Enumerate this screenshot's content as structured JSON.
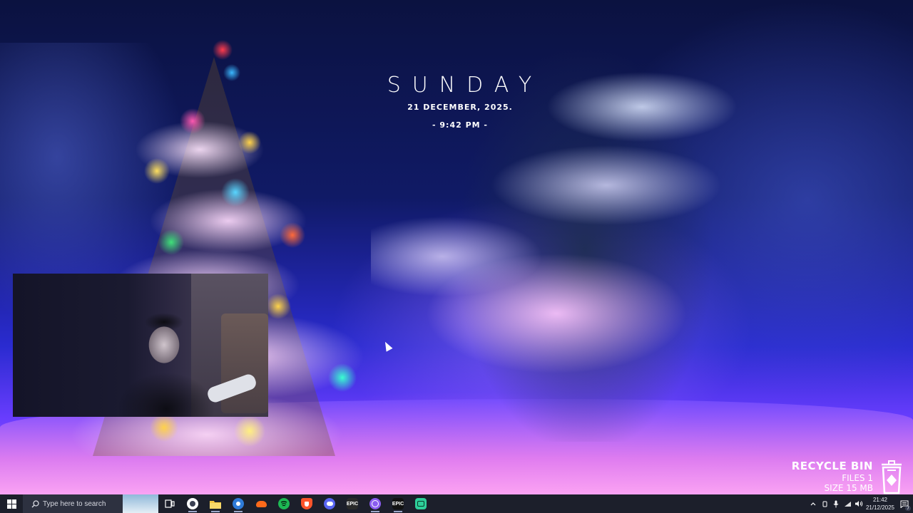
{
  "clock": {
    "day": "SUNDAY",
    "date": "21 DECEMBER, 2025.",
    "time": "- 9:42 PM -"
  },
  "recycle_bin": {
    "title": "RECYCLE BIN",
    "files": "FILES 1",
    "size": "SIZE 15 MB"
  },
  "taskbar": {
    "search_placeholder": "Type here to search",
    "apps": [
      {
        "name": "Task View",
        "icon": "task-view-icon"
      },
      {
        "name": "Browser",
        "icon": "browser-icon"
      },
      {
        "name": "File Explorer",
        "icon": "folder-icon"
      },
      {
        "name": "App",
        "icon": "app-blue-icon"
      },
      {
        "name": "SoundCloud",
        "icon": "cloud-orange-icon"
      },
      {
        "name": "Spotify",
        "icon": "spotify-icon"
      },
      {
        "name": "Brave",
        "icon": "brave-icon"
      },
      {
        "name": "Discord",
        "icon": "discord-icon"
      },
      {
        "name": "Epic Games",
        "icon": "epic-games-icon",
        "label": "EPIC"
      },
      {
        "name": "Circle App",
        "icon": "circle-app-icon"
      },
      {
        "name": "Epic Games",
        "icon": "epic-games-icon",
        "label": "EPIC"
      },
      {
        "name": "Green App",
        "icon": "green-app-icon"
      }
    ],
    "tray": {
      "time": "21:42",
      "date": "21/12/2025",
      "notifications": "7"
    }
  },
  "colors": {
    "taskbar_bg": "#1c1f2b",
    "spotify": "#1db954",
    "brave": "#fb542b",
    "discord": "#5865f2"
  }
}
